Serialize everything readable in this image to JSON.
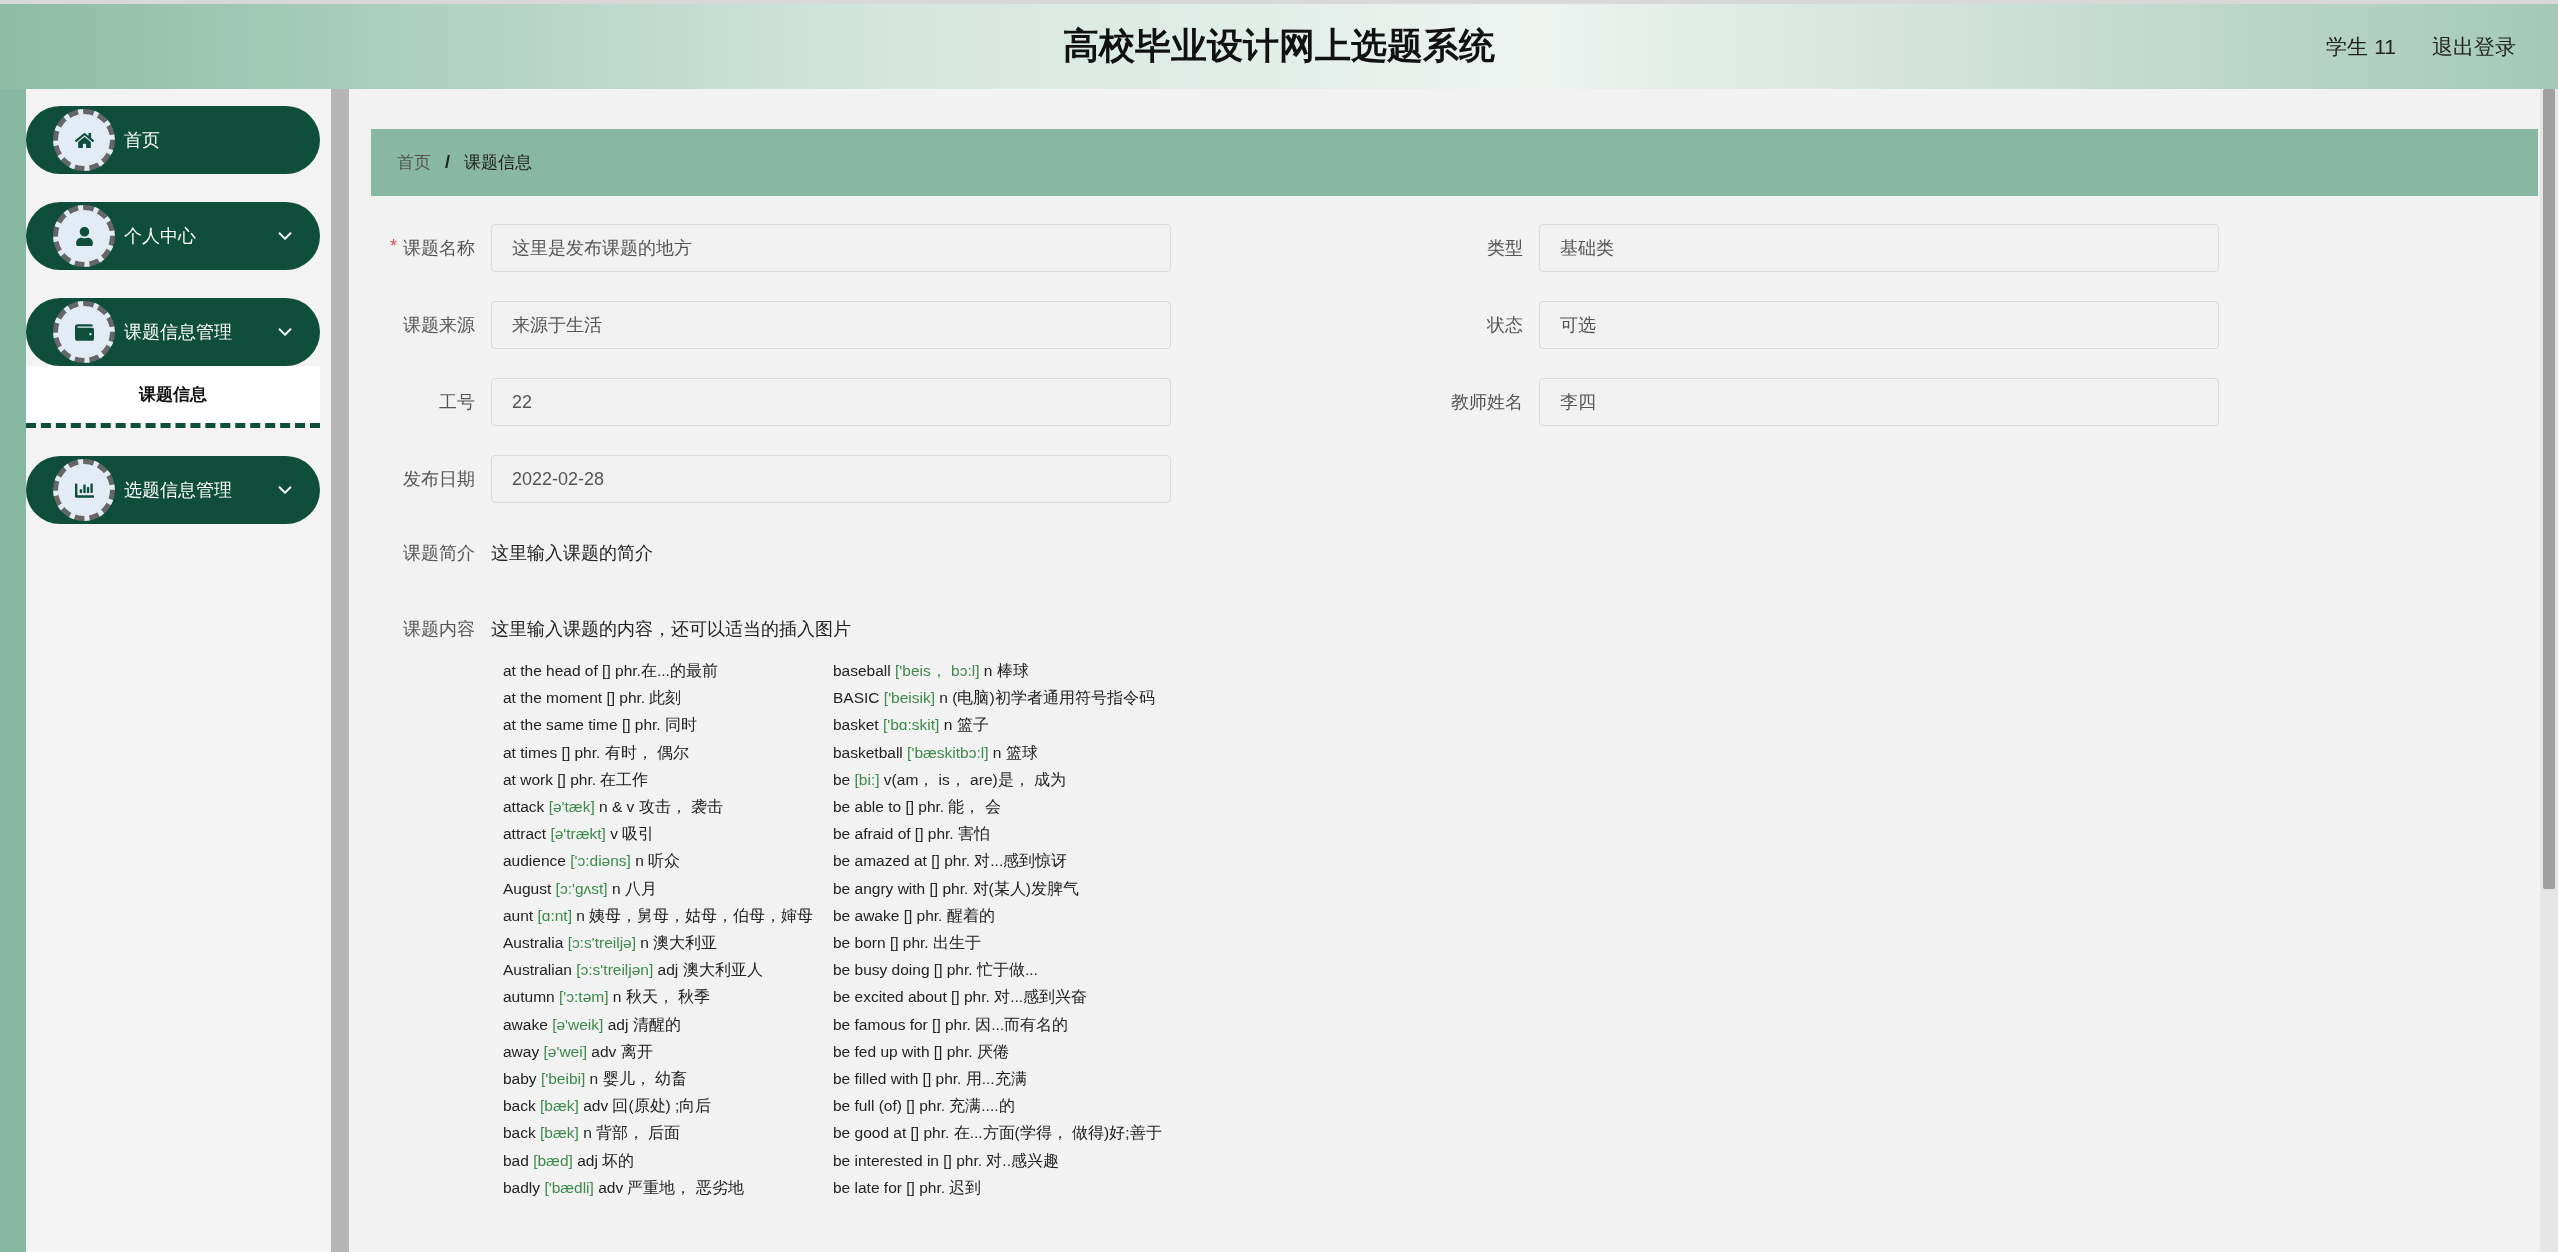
{
  "header": {
    "title": "高校毕业设计网上选题系统",
    "user": "学生 11",
    "logout": "退出登录"
  },
  "sidebar": {
    "items": [
      {
        "label": "首页",
        "kind": "link"
      },
      {
        "label": "个人中心",
        "kind": "submenu"
      },
      {
        "label": "课题信息管理",
        "kind": "submenu",
        "children": [
          {
            "label": "课题信息",
            "selected": true
          }
        ]
      },
      {
        "label": "选题信息管理",
        "kind": "submenu"
      }
    ]
  },
  "breadcrumb": [
    "首页",
    "课题信息"
  ],
  "breadcrumb_separator": "/",
  "form": {
    "fields": [
      {
        "label": "课题名称",
        "value": "这里是发布课题的地方",
        "required_mark": "*"
      },
      {
        "label": "类型",
        "value": "基础类"
      },
      {
        "label": "课题来源",
        "value": "来源于生活"
      },
      {
        "label": "状态",
        "value": "可选"
      },
      {
        "label": "工号",
        "value": "22"
      },
      {
        "label": "教师姓名",
        "value": "李四"
      },
      {
        "label": "发布日期",
        "value": "2022-02-28"
      }
    ],
    "intro": {
      "label": "课题简介",
      "text": "这里输入课题的简介"
    },
    "content": {
      "label": "课题内容",
      "text": "这里输入课题的内容，还可以适当的插入图片",
      "vocabulary_columns": [
        [
          {
            "word": "at the head of [] phr.在...的最前"
          },
          {
            "word": "at the moment [] phr. 此刻"
          },
          {
            "word": "at the same time [] phr. 同时"
          },
          {
            "word": "at times [] phr. 有时， 偶尔"
          },
          {
            "word": "at work  [] phr. 在工作"
          },
          {
            "word": "attack",
            "phonetic": "[ə'tæk]",
            "meaning": "n & v 攻击， 袭击"
          },
          {
            "word": "attract",
            "phonetic": "[ə'trækt]",
            "meaning": "v 吸引"
          },
          {
            "word": "audience",
            "phonetic": "['ɔ:diəns]",
            "meaning": "n 听众"
          },
          {
            "word": "August",
            "phonetic": "[ɔ:'gʌst]",
            "meaning": "n 八月"
          },
          {
            "word": "aunt",
            "phonetic": "[ɑ:nt]",
            "meaning": "n 姨母，舅母，姑母，伯母，婶母"
          },
          {
            "word": "Australia",
            "phonetic": "[ɔ:s'treiljə]",
            "meaning": "n 澳大利亚"
          },
          {
            "word": "Australian",
            "phonetic": "[ɔ:s'treiljən]",
            "meaning": "adj 澳大利亚人"
          },
          {
            "word": "autumn",
            "phonetic": "['ɔ:təm]",
            "meaning": "n 秋天， 秋季"
          },
          {
            "word": "awake",
            "phonetic": "[ə'weik]",
            "meaning": "adj 清醒的"
          },
          {
            "word": "away",
            "phonetic": "[ə'wei]",
            "meaning": "adv 离开"
          },
          {
            "word": "baby",
            "phonetic": "['beibi]",
            "meaning": "n 婴儿， 幼畜"
          },
          {
            "word": "back",
            "phonetic": "[bæk]",
            "meaning": "adv 回(原处) ;向后"
          },
          {
            "word": "back",
            "phonetic": "[bæk]",
            "meaning": "n 背部， 后面"
          },
          {
            "word": "bad",
            "phonetic": "[bæd]",
            "meaning": "adj 坏的"
          },
          {
            "word": "badly",
            "phonetic": "['bædli]",
            "meaning": "adv 严重地， 恶劣地"
          }
        ],
        [
          {
            "word": "baseball",
            "phonetic": "['beis， bɔ:l]",
            "meaning": "n 棒球"
          },
          {
            "word": "BASIC",
            "phonetic": "['beisik]",
            "meaning": "n (电脑)初学者通用符号指令码"
          },
          {
            "word": "basket",
            "phonetic": "['bɑ:skit]",
            "meaning": "n 篮子"
          },
          {
            "word": "basketball",
            "phonetic": "['bæskitbɔ:l]",
            "meaning": "n 篮球"
          },
          {
            "word": "be",
            "phonetic": "[bi:]",
            "meaning": "v(am， is， are)是， 成为"
          },
          {
            "word": "be able to [] phr. 能， 会"
          },
          {
            "word": "be afraid of [] phr. 害怕"
          },
          {
            "word": "be amazed at [] phr. 对...感到惊讶"
          },
          {
            "word": "be angry with [] phr. 对(某人)发脾气"
          },
          {
            "word": "be awake [] phr. 醒着的"
          },
          {
            "word": "be born [] phr. 出生于"
          },
          {
            "word": "be busy doing [] phr. 忙于做..."
          },
          {
            "word": "be excited about [] phr. 对...感到兴奋"
          },
          {
            "word": "be famous for [] phr. 因...而有名的"
          },
          {
            "word": "be fed up with [] phr. 厌倦"
          },
          {
            "word": "be filled with [] phr. 用...充满"
          },
          {
            "word": "be full (of) [] phr. 充满....的"
          },
          {
            "word": "be good at [] phr. 在...方面(学得， 做得)好;善于"
          },
          {
            "word": "be interested in [] phr. 对..感兴趣"
          },
          {
            "word": "be late for [] phr. 迟到"
          }
        ]
      ]
    }
  }
}
